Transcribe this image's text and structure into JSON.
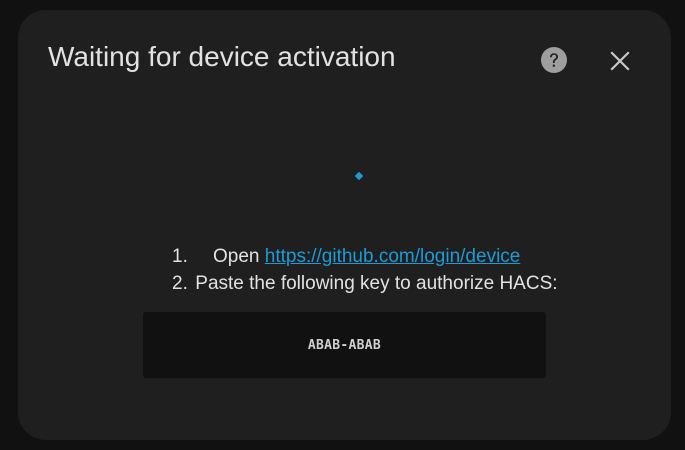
{
  "dialog": {
    "title": "Waiting for device activation",
    "help_icon": "help-circle-icon",
    "close_icon": "close-icon"
  },
  "steps": [
    {
      "number": "1.",
      "prefix": "Open",
      "link_text": "https://github.com/login/device"
    },
    {
      "number": "2.",
      "text": "Paste the following key to authorize HACS:"
    }
  ],
  "device_code": "ABAB-ABAB",
  "colors": {
    "background": "#111111",
    "dialog": "#1f1f1f",
    "text": "#e2e2e2",
    "link": "#1f9ad6",
    "code_box": "#111111",
    "icon": "#9e9e9e"
  }
}
